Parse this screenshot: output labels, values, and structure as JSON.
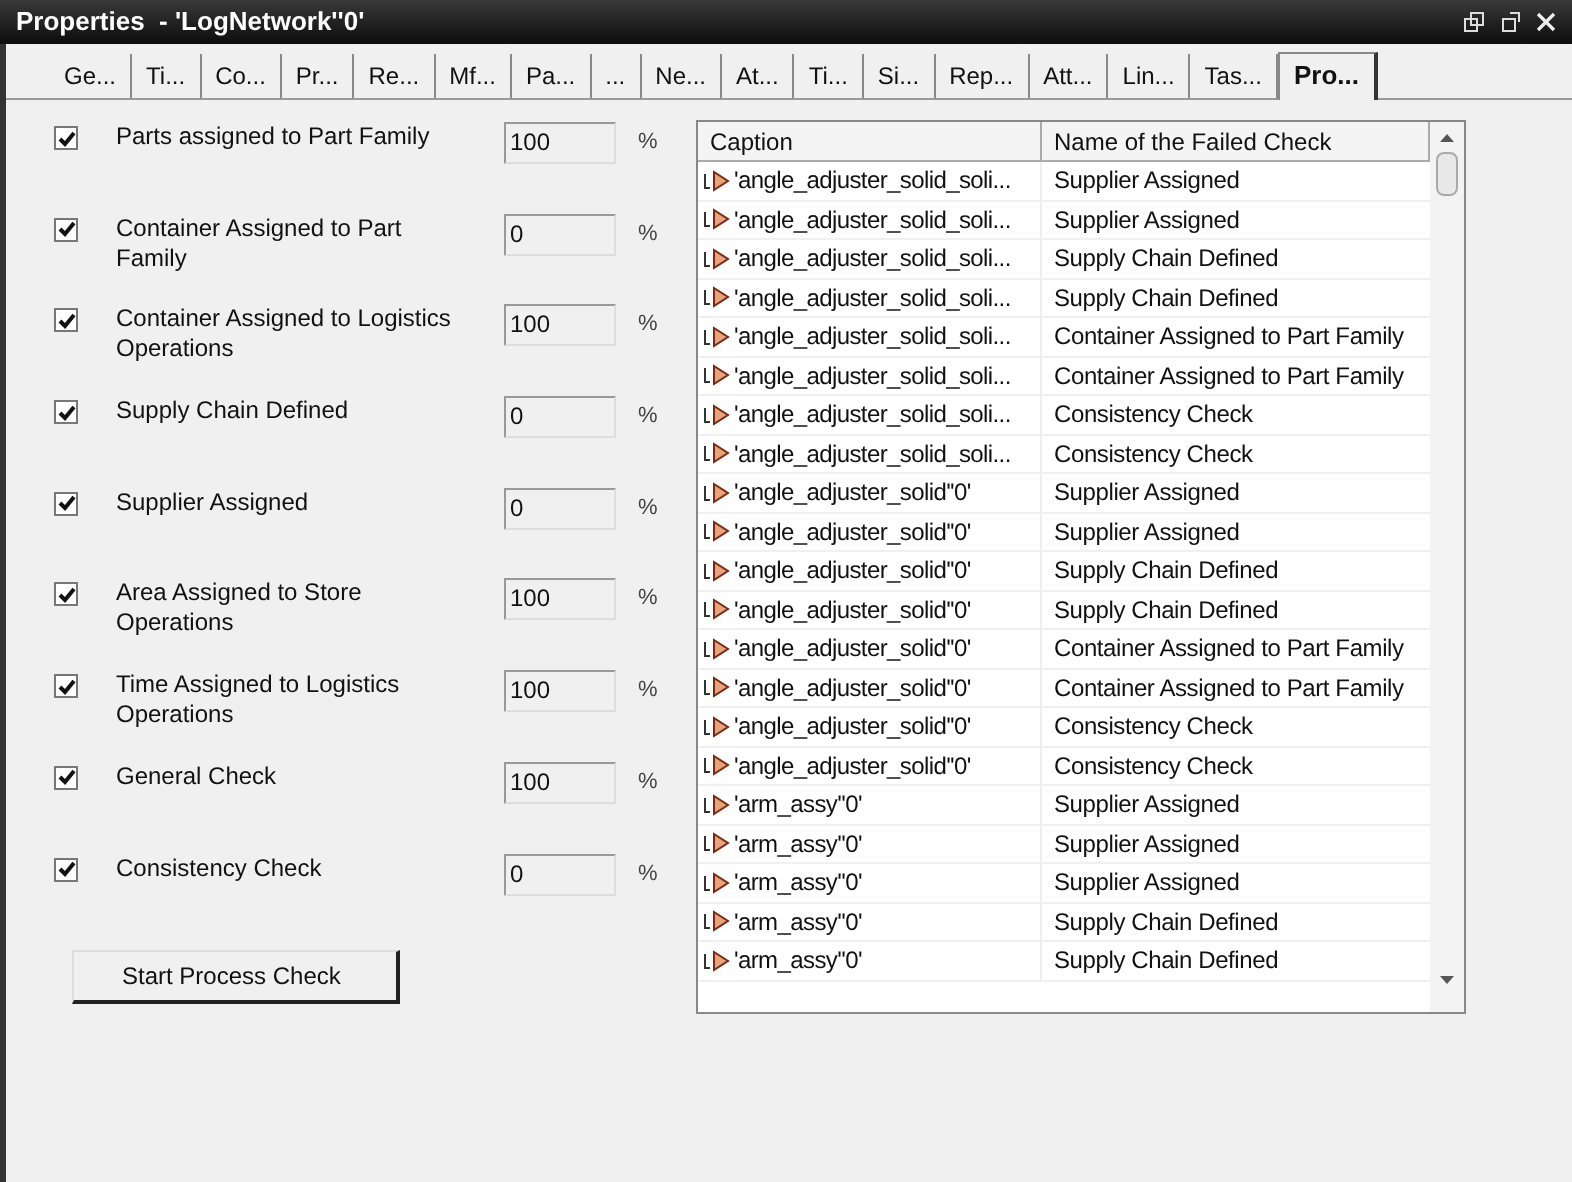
{
  "window": {
    "title": "Properties  - 'LogNetwork''0'"
  },
  "tabs": [
    {
      "label": "Ge...",
      "selected": false
    },
    {
      "label": "Ti...",
      "selected": false
    },
    {
      "label": "Co...",
      "selected": false
    },
    {
      "label": "Pr...",
      "selected": false
    },
    {
      "label": "Re...",
      "selected": false
    },
    {
      "label": "Mf...",
      "selected": false
    },
    {
      "label": "Pa...",
      "selected": false
    },
    {
      "label": "...",
      "selected": false
    },
    {
      "label": "Ne...",
      "selected": false
    },
    {
      "label": "At...",
      "selected": false
    },
    {
      "label": "Ti...",
      "selected": false
    },
    {
      "label": "Si...",
      "selected": false
    },
    {
      "label": "Rep...",
      "selected": false
    },
    {
      "label": "Att...",
      "selected": false
    },
    {
      "label": "Lin...",
      "selected": false
    },
    {
      "label": "Tas...",
      "selected": false
    },
    {
      "label": "Pro...",
      "selected": true
    }
  ],
  "checks": [
    {
      "label": "Parts assigned to Part Family",
      "checked": true,
      "value": "100",
      "unit": "%"
    },
    {
      "label": "Container Assigned to Part Family",
      "checked": true,
      "value": "0",
      "unit": "%"
    },
    {
      "label": "Container Assigned to Logistics Operations",
      "checked": true,
      "value": "100",
      "unit": "%"
    },
    {
      "label": "Supply Chain Defined",
      "checked": true,
      "value": "0",
      "unit": "%"
    },
    {
      "label": "Supplier Assigned",
      "checked": true,
      "value": "0",
      "unit": "%"
    },
    {
      "label": "Area Assigned to Store Operations",
      "checked": true,
      "value": "100",
      "unit": "%"
    },
    {
      "label": "Time Assigned to Logistics Operations",
      "checked": true,
      "value": "100",
      "unit": "%"
    },
    {
      "label": "General Check",
      "checked": true,
      "value": "100",
      "unit": "%"
    },
    {
      "label": "Consistency Check",
      "checked": true,
      "value": "0",
      "unit": "%"
    }
  ],
  "start_button": "Start Process Check",
  "table": {
    "columns": [
      "Caption",
      "Name of the Failed Check"
    ],
    "rows": [
      [
        "'angle_adjuster_solid_soli...",
        "Supplier Assigned"
      ],
      [
        "'angle_adjuster_solid_soli...",
        "Supplier Assigned"
      ],
      [
        "'angle_adjuster_solid_soli...",
        "Supply Chain Defined"
      ],
      [
        "'angle_adjuster_solid_soli...",
        "Supply Chain Defined"
      ],
      [
        "'angle_adjuster_solid_soli...",
        "Container Assigned to Part Family"
      ],
      [
        "'angle_adjuster_solid_soli...",
        "Container Assigned to Part Family"
      ],
      [
        "'angle_adjuster_solid_soli...",
        "Consistency Check"
      ],
      [
        "'angle_adjuster_solid_soli...",
        "Consistency Check"
      ],
      [
        "'angle_adjuster_solid''0'",
        "Supplier Assigned"
      ],
      [
        "'angle_adjuster_solid''0'",
        "Supplier Assigned"
      ],
      [
        "'angle_adjuster_solid''0'",
        "Supply Chain Defined"
      ],
      [
        "'angle_adjuster_solid''0'",
        "Supply Chain Defined"
      ],
      [
        "'angle_adjuster_solid''0'",
        "Container Assigned to Part Family"
      ],
      [
        "'angle_adjuster_solid''0'",
        "Container Assigned to Part Family"
      ],
      [
        "'angle_adjuster_solid''0'",
        "Consistency Check"
      ],
      [
        "'angle_adjuster_solid''0'",
        "Consistency Check"
      ],
      [
        "'arm_assy''0'",
        "Supplier Assigned"
      ],
      [
        "'arm_assy''0'",
        "Supplier Assigned"
      ],
      [
        "'arm_assy''0'",
        "Supplier Assigned"
      ],
      [
        "'arm_assy''0'",
        "Supply Chain Defined"
      ],
      [
        "'arm_assy''0'",
        "Supply Chain Defined"
      ]
    ]
  }
}
